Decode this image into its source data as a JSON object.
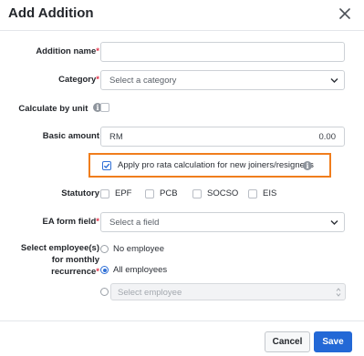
{
  "dialog": {
    "title": "Add Addition"
  },
  "form": {
    "addition_name": {
      "label": "Addition name",
      "required_mark": "*",
      "value": ""
    },
    "category": {
      "label": "Category",
      "required_mark": "*",
      "placeholder": "Select a category"
    },
    "calculate_by_unit": {
      "label": "Calculate by unit",
      "checked": false
    },
    "basic_amount": {
      "label": "Basic amount",
      "currency": "RM",
      "value": "0.00"
    },
    "pro_rata": {
      "label": "Apply pro rata calculation for new joiners/resignees",
      "checked": true
    },
    "statutory": {
      "label": "Statutory",
      "options": [
        {
          "label": "EPF",
          "checked": false
        },
        {
          "label": "PCB",
          "checked": false
        },
        {
          "label": "SOCSO",
          "checked": false
        },
        {
          "label": "EIS",
          "checked": false
        }
      ]
    },
    "ea_form_field": {
      "label": "EA form field",
      "required_mark": "*",
      "placeholder": "Select a field"
    },
    "monthly_recurrence": {
      "label_line1": "Select employee(s)",
      "label_line2": "for monthly",
      "label_line3": "recurrence",
      "required_mark": "*",
      "options": [
        {
          "label": "No employee",
          "selected": false
        },
        {
          "label": "All employees",
          "selected": true
        }
      ],
      "select_employee_placeholder": "Select employee"
    }
  },
  "footer": {
    "cancel_label": "Cancel",
    "save_label": "Save"
  },
  "colors": {
    "primary": "#2368d6",
    "highlight_border": "#f07d1c",
    "required": "#e0334a"
  }
}
